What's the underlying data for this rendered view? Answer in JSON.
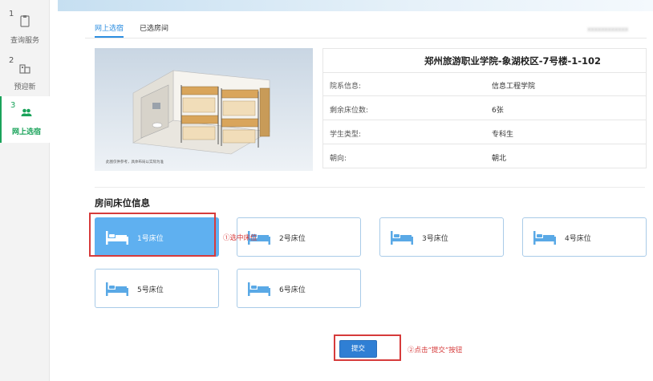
{
  "steps": [
    {
      "num": "1",
      "label": "查询服务"
    },
    {
      "num": "2",
      "label": "预迎新"
    },
    {
      "num": "3",
      "label": "网上选宿"
    }
  ],
  "tabs": [
    {
      "label": "网上选宿",
      "active": true
    },
    {
      "label": "已选房间",
      "active": false
    }
  ],
  "blurred_user": "xxxxxxxxxxxx",
  "room": {
    "title": "郑州旅游职业学院-象湖校区-7号楼-1-102",
    "image_caption": "此图仅供参考，具体布局以实际为准",
    "rows": [
      {
        "key": "院系信息:",
        "value": "信息工程学院"
      },
      {
        "key": "剩余床位数:",
        "value": "6张"
      },
      {
        "key": "学生类型:",
        "value": "专科生"
      },
      {
        "key": "朝向:",
        "value": "朝北"
      }
    ]
  },
  "section_title": "房间床位信息",
  "beds": [
    {
      "label": "1号床位",
      "selected": true
    },
    {
      "label": "2号床位",
      "selected": false
    },
    {
      "label": "3号床位",
      "selected": false
    },
    {
      "label": "4号床位",
      "selected": false
    },
    {
      "label": "5号床位",
      "selected": false
    },
    {
      "label": "6号床位",
      "selected": false
    }
  ],
  "notes": {
    "select": "①选中床位",
    "submit": "②点击“提交”按钮"
  },
  "submit_label": "提交",
  "colors": {
    "accent": "#2d8ee0",
    "active_step": "#1aa35a",
    "selected_bed": "#5fb0f0",
    "annotation": "#d63b3b"
  }
}
